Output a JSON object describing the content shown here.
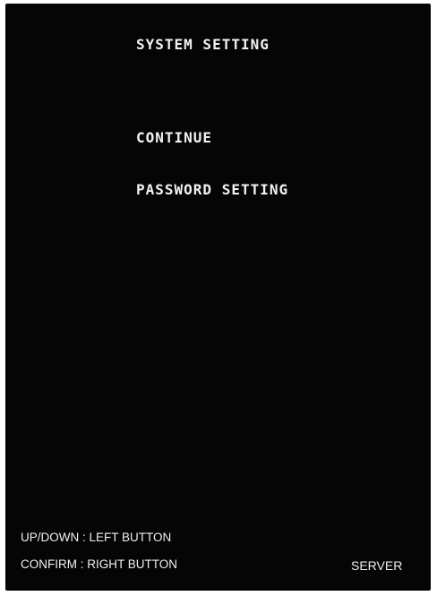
{
  "screen": {
    "title": "SYSTEM SETTING"
  },
  "menu": {
    "items": [
      {
        "label": "CONTINUE"
      },
      {
        "label": "PASSWORD SETTING"
      }
    ]
  },
  "footer": {
    "hint_updown": "UP/DOWN : LEFT BUTTON",
    "hint_confirm": "CONFIRM : RIGHT BUTTON",
    "server_label": "SERVER"
  },
  "colors": {
    "background": "#050505",
    "text": "#f2f2f2",
    "frame": "#ffffff"
  }
}
